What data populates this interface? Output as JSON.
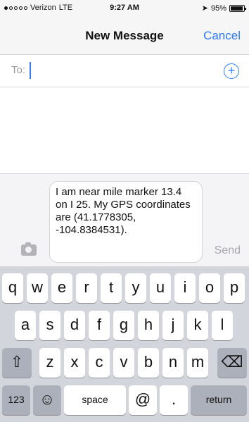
{
  "status": {
    "carrier": "Verizon",
    "network": "LTE",
    "time": "9:27 AM",
    "battery_text": "95%",
    "battery_level": 0.95
  },
  "nav": {
    "title": "New Message",
    "cancel_label": "Cancel"
  },
  "to_field": {
    "label": "To:",
    "value": ""
  },
  "compose": {
    "message": "I am near mile marker 13.4 on I 25. My GPS coordinates are (41.1778305, -104.8384531).",
    "send_label": "Send"
  },
  "keyboard": {
    "row1": [
      "q",
      "w",
      "e",
      "r",
      "t",
      "y",
      "u",
      "i",
      "o",
      "p"
    ],
    "row2": [
      "a",
      "s",
      "d",
      "f",
      "g",
      "h",
      "j",
      "k",
      "l"
    ],
    "row3": [
      "z",
      "x",
      "c",
      "v",
      "b",
      "n",
      "m"
    ],
    "shift_glyph": "⇧",
    "backspace_glyph": "⌫",
    "numbers_label": "123",
    "emoji_glyph": "☺",
    "space_label": "space",
    "at_label": "@",
    "period_label": ".",
    "return_label": "return"
  }
}
